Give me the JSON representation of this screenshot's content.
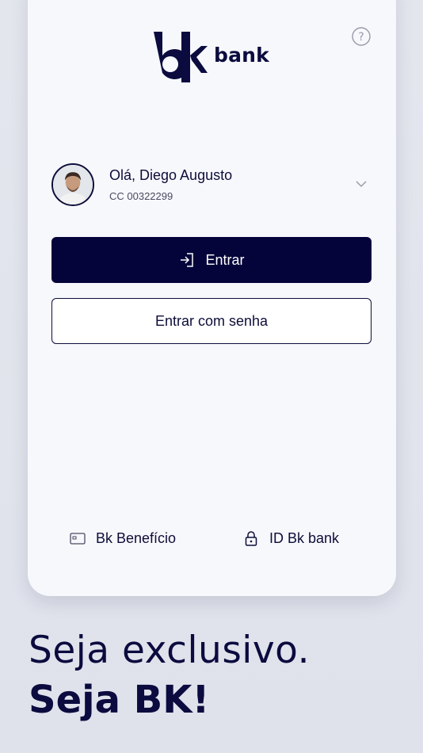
{
  "brand": {
    "word": "bank",
    "primary_color": "#04033a",
    "background_color": "#e2e4ec"
  },
  "header": {
    "help_icon": "question-circle-icon"
  },
  "account": {
    "greeting": "Olá, Diego Augusto",
    "number": "CC 00322299",
    "expand_icon": "chevron-down-icon"
  },
  "actions": {
    "enter_label": "Entrar",
    "enter_icon": "login-arrow-icon",
    "enter_password_label": "Entrar com senha"
  },
  "footer": {
    "beneficio_label": "Bk Benefício",
    "beneficio_icon": "card-icon",
    "id_label": "ID Bk bank",
    "id_icon": "lock-icon"
  },
  "tagline": {
    "line1": "Seja exclusivo.",
    "line2": "Seja BK!"
  }
}
